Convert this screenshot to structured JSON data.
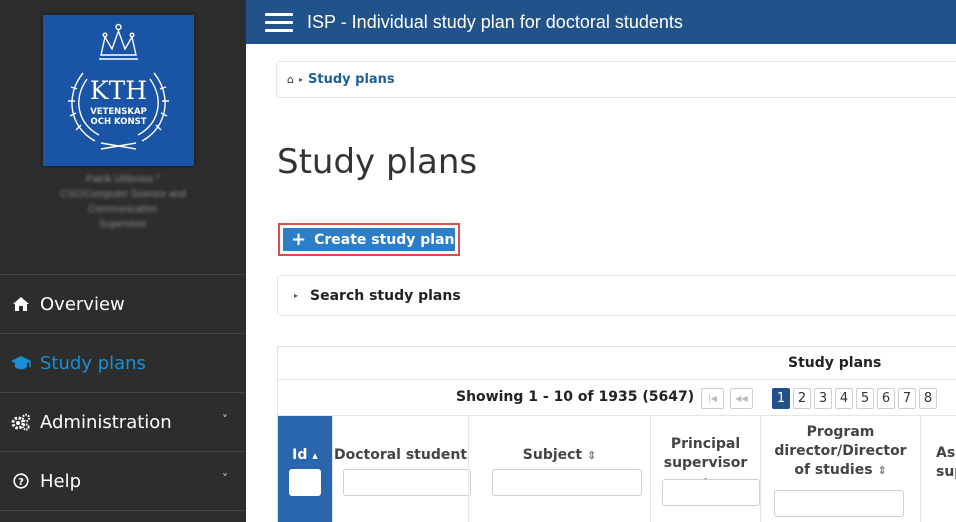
{
  "header": {
    "title": "ISP - Individual study plan for doctoral students"
  },
  "logo": {
    "line1": "KTH",
    "line2": "VETENSKAP",
    "line3": "OCH KONST"
  },
  "user": {
    "lines": [
      "Patrik Uhlenius *",
      "CSC/Computer Science and",
      "Communication",
      "Supervisor"
    ]
  },
  "sidebar": {
    "items": [
      {
        "label": "Overview",
        "icon": "home-icon"
      },
      {
        "label": "Study plans",
        "icon": "graduation-cap-icon"
      },
      {
        "label": "Administration",
        "icon": "cogs-icon"
      },
      {
        "label": "Help",
        "icon": "question-circle-icon"
      }
    ],
    "chevron": "˅"
  },
  "breadcrumb": {
    "home": "⌂",
    "separator": "▸",
    "current": "Study plans"
  },
  "page": {
    "title": "Study plans"
  },
  "actions": {
    "create_plus": "+",
    "create_label": "Create study plan"
  },
  "search": {
    "toggle": "▸",
    "label": "Search study plans"
  },
  "table": {
    "caption": "Study plans",
    "showing": "Showing 1 - 10 of 1935  (5647)",
    "pager": {
      "first": "|◀",
      "prev": "◀◀",
      "pages": [
        "1",
        "2",
        "3",
        "4",
        "5",
        "6",
        "7",
        "8"
      ],
      "active_page": "1"
    },
    "columns": [
      {
        "label": "Id",
        "sort": "▴"
      },
      {
        "label": "Doctoral student",
        "sort": "⇕"
      },
      {
        "label": "Subject",
        "sort": "⇕"
      },
      {
        "label": "Principal supervisor",
        "sort": "⇕"
      },
      {
        "label": "Program director/Director of studies",
        "sort": "⇕"
      },
      {
        "label": "Ass sup",
        "sort": ""
      }
    ]
  },
  "colors": {
    "header_bg": "#21528a",
    "sidebar_bg": "#2d2d2d",
    "accent": "#1a8fd6",
    "button_bg": "#2c7fc6",
    "highlight_border": "#e24b4b"
  }
}
